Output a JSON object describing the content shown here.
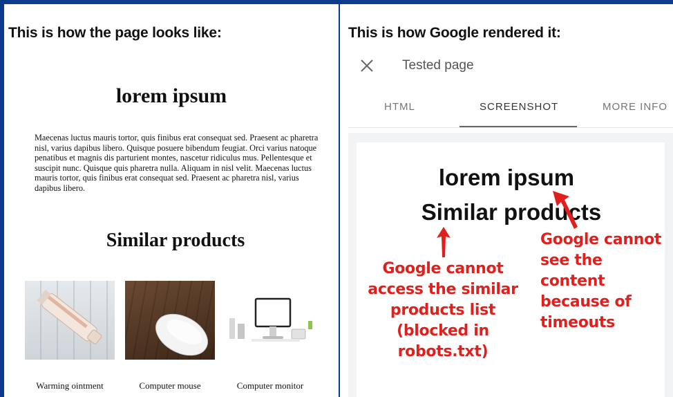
{
  "left": {
    "caption": "This is how the page looks like:",
    "page_title": "lorem ipsum",
    "paragraph": "Maecenas luctus mauris tortor, quis finibus erat consequat sed. Praesent ac pharetra nisl, varius dapibus libero. Quisque posuere bibendum feugiat. Orci varius natoque penatibus et magnis dis parturient montes, nascetur ridiculus mus. Pellentesque et suscipit nunc. Quisque quis pharetra nulla. Aliquam in nisl velit. Maecenas luctus mauris tortor, quis finibus erat consequat sed. Praesent ac pharetra nisl, varius dapibus libero.",
    "similar_heading": "Similar products",
    "products": [
      {
        "name": "Warming ointment"
      },
      {
        "name": "Computer mouse"
      },
      {
        "name": "Computer monitor"
      }
    ]
  },
  "right": {
    "caption": "This is how Google rendered it:",
    "dialog_title": "Tested page",
    "tabs": [
      {
        "label": "HTML"
      },
      {
        "label": "SCREENSHOT"
      },
      {
        "label": "MORE INFO"
      }
    ],
    "active_tab": "SCREENSHOT",
    "rendered_title": "lorem ipsum",
    "rendered_similar": "Similar products",
    "annotation_robots": "Google cannot access the similar products list (blocked in robots.txt)",
    "annotation_timeouts": "Google cannot see the content because of timeouts"
  },
  "colors": {
    "frame": "#0b3a8f",
    "annotation": "#e0201c"
  }
}
